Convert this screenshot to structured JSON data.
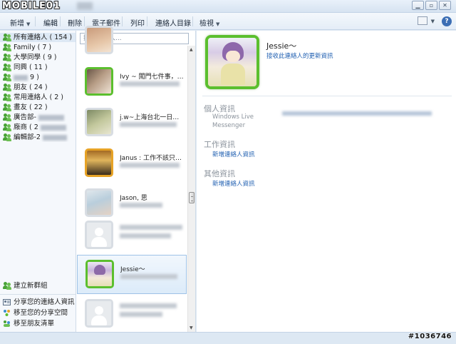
{
  "window": {
    "logo_text": "MOBILE01"
  },
  "menubar": {
    "items": [
      {
        "label": "新增",
        "has_caret": true
      },
      {
        "label": "編輯"
      },
      {
        "label": "刪除"
      },
      {
        "label": "電子郵件"
      },
      {
        "label": "列印"
      },
      {
        "label": "連絡人目錄"
      },
      {
        "label": "檢視",
        "has_caret": true
      }
    ],
    "help_label": "?"
  },
  "sidebar": {
    "groups": [
      {
        "label": "所有連絡人 ( 154 )",
        "selected": true
      },
      {
        "label": "Family ( 7 )"
      },
      {
        "label": "大學同學 ( 9 )"
      },
      {
        "label": "同興 ( 11 )"
      },
      {
        "label": "9 )",
        "blurred_prefix": true
      },
      {
        "label": "朋友 ( 24 )"
      },
      {
        "label": "常用連絡人 ( 2 )"
      },
      {
        "label": "畫友 ( 22 )"
      },
      {
        "label": "廣告部-",
        "blurred_suffix": true
      },
      {
        "label": "廠商 ( 2",
        "blurred_suffix": true
      },
      {
        "label": "編輯部-2",
        "blurred_suffix": true
      }
    ],
    "create_group": "建立新群組",
    "actions": [
      {
        "label": "分享您的連絡人資訊",
        "icon": "share-card-icon"
      },
      {
        "label": "移至您的分享空間",
        "icon": "share-space-icon"
      },
      {
        "label": "移至朋友清單",
        "icon": "friends-list-icon"
      }
    ]
  },
  "search": {
    "placeholder": "搜尋連絡人..."
  },
  "contacts": [
    {
      "name": "",
      "status": "offline",
      "partial": true
    },
    {
      "name": "Ivy ~ 闖門七件事，僅米...",
      "status": "online"
    },
    {
      "name": "j.w~上海台北一日生活...",
      "status": "offline"
    },
    {
      "name": "Janus : 工作不該只是工...",
      "status": "busy"
    },
    {
      "name": "Jason, 思",
      "status": "offline"
    },
    {
      "name": "",
      "status": "offline",
      "blurred": true
    },
    {
      "name": "Jessie～",
      "status": "online",
      "selected": true
    },
    {
      "name": "",
      "status": "offline",
      "blurred": true
    }
  ],
  "profile": {
    "name": "Jessie～",
    "update_link": "接收此連絡人的更新資訊",
    "sections": [
      {
        "title": "個人資訊",
        "lines": [
          "Windows Live",
          "Messenger"
        ]
      },
      {
        "title": "工作資訊",
        "link": "新增連絡人資訊"
      },
      {
        "title": "其他資訊",
        "link": "新增連絡人資訊"
      }
    ]
  },
  "watermark": "#1036746",
  "colors": {
    "online": "#5bbf2e",
    "busy": "#e7a326",
    "link": "#1f5fb1",
    "selection": "#dcebf9"
  }
}
